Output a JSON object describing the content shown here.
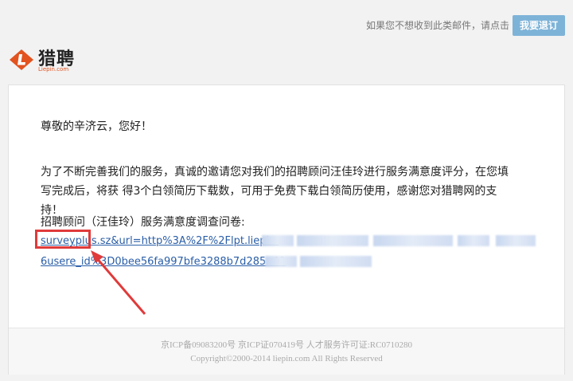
{
  "topbar": {
    "notice": "如果您不想收到此类邮件，请点击",
    "unsubscribe_label": "我要退订"
  },
  "logo": {
    "cn": "猎聘",
    "en": "Liepin.com",
    "brand_color": "#e2531f"
  },
  "email": {
    "greeting": "尊敬的辛济云，您好！",
    "paragraph": "为了不断完善我们的服务，真诚的邀请您对我们的招聘顾问汪佳玲进行服务满意度评分，在您填写完成后，将获 得3个白领简历下载数，可用于免费下载白领简历使用，感谢您对猎聘网的支持！",
    "survey_label": "招聘顾问（汪佳玲）服务满意度调查问卷:",
    "link_line1": "surveyplus.sz&url=http%3A%2F%2Flpt.liepin.",
    "link_line2": "6usere_id%3D0bee56fa997bfe3288b7d285e49"
  },
  "footer": {
    "line1": "京ICP备09083200号 京ICP证070419号 人才服务许可证:RC0710280",
    "line2": "Copyright©2000-2014 liepin.com All Rights Reserved"
  },
  "annotation": {
    "color": "#e03a3a"
  }
}
